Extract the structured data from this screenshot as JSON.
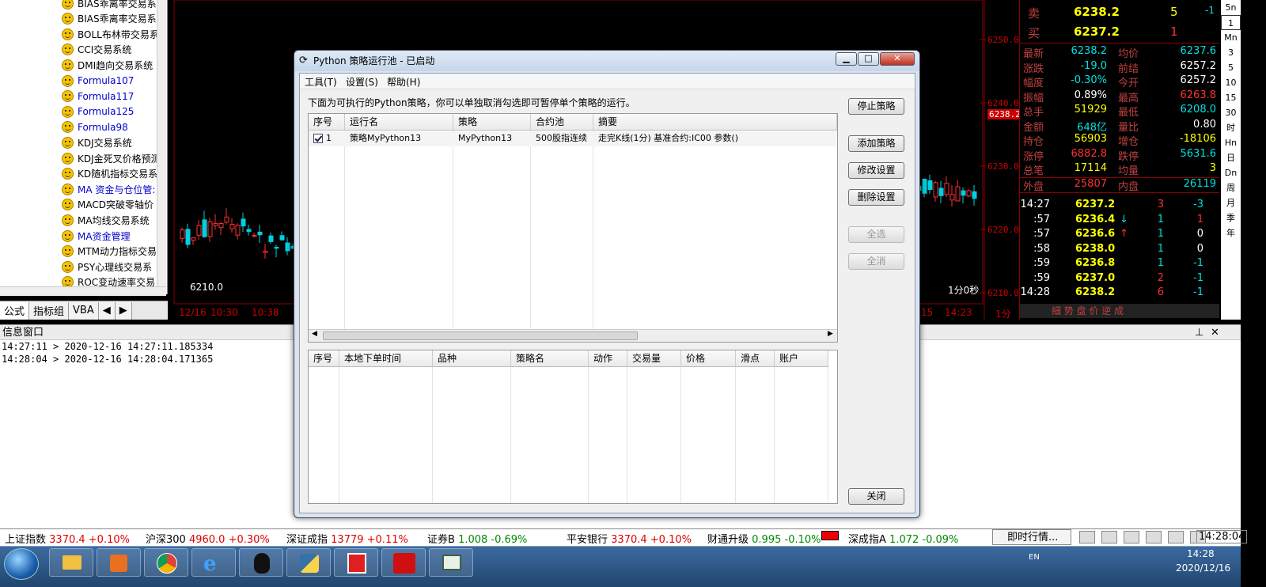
{
  "tree": {
    "items": [
      {
        "label": "BIAS乖离率交易系",
        "blue": false
      },
      {
        "label": "BIAS乖离率交易系",
        "blue": false
      },
      {
        "label": "BOLL布林带交易系",
        "blue": false
      },
      {
        "label": "CCI交易系统",
        "blue": false
      },
      {
        "label": "DMI趋向交易系统",
        "blue": false
      },
      {
        "label": "Formula107",
        "blue": true
      },
      {
        "label": "Formula117",
        "blue": true
      },
      {
        "label": "Formula125",
        "blue": true
      },
      {
        "label": "Formula98",
        "blue": true
      },
      {
        "label": "KDJ交易系统",
        "blue": false
      },
      {
        "label": "KDJ金死叉价格预测",
        "blue": false
      },
      {
        "label": "KD随机指标交易系",
        "blue": false
      },
      {
        "label": "MA 资金与仓位管:",
        "blue": true
      },
      {
        "label": "MACD突破零轴价",
        "blue": false
      },
      {
        "label": "MA均线交易系统",
        "blue": false
      },
      {
        "label": "MA资金管理",
        "blue": true
      },
      {
        "label": "MTM动力指标交易",
        "blue": false
      },
      {
        "label": "PSY心理线交易系",
        "blue": false
      },
      {
        "label": "ROC变动速率交易",
        "blue": false
      }
    ],
    "tabs": [
      "公式",
      "指标组",
      "VBA"
    ]
  },
  "chart": {
    "price_labels": [
      "6250.0",
      "6240.0",
      "6230.0",
      "6220.0",
      "6210.0"
    ],
    "current_price": "6238.2",
    "low_label": "6210.0",
    "time_labels": [
      "12/16",
      "10:30",
      "10:38",
      "15",
      "14:23"
    ],
    "period": "1分",
    "countdown": "1分0秒"
  },
  "quote": {
    "sell": {
      "label": "卖",
      "price": "6238.2",
      "vol": "5",
      "diff": "-1"
    },
    "buy": {
      "label": "买",
      "price": "6237.2",
      "vol": "1"
    },
    "rows": [
      {
        "l1": "最新",
        "v1": "6238.2",
        "c1": "green",
        "l2": "均价",
        "v2": "6237.6",
        "c2": "green"
      },
      {
        "l1": "涨跌",
        "v1": "-19.0",
        "c1": "green",
        "l2": "前结",
        "v2": "6257.2",
        "c2": "white"
      },
      {
        "l1": "幅度",
        "v1": "-0.30%",
        "c1": "green",
        "l2": "今开",
        "v2": "6257.2",
        "c2": "white"
      },
      {
        "l1": "振幅",
        "v1": "0.89%",
        "c1": "white",
        "l2": "最高",
        "v2": "6263.8",
        "c2": "red"
      },
      {
        "l1": "总手",
        "v1": "51929",
        "c1": "yel",
        "l2": "最低",
        "v2": "6208.0",
        "c2": "green"
      },
      {
        "l1": "金额",
        "v1": "648亿",
        "c1": "green",
        "l2": "量比",
        "v2": "0.80",
        "c2": "white"
      },
      {
        "l1": "持仓",
        "v1": "56903",
        "c1": "yel",
        "l2": "增仓",
        "v2": "-18106",
        "c2": "yel"
      },
      {
        "l1": "涨停",
        "v1": "6882.8",
        "c1": "red",
        "l2": "跌停",
        "v2": "5631.6",
        "c2": "green"
      },
      {
        "l1": "总笔",
        "v1": "17114",
        "c1": "yel",
        "l2": "均量",
        "v2": "3",
        "c2": "yel"
      },
      {
        "l1": "外盘",
        "v1": "25807",
        "c1": "red",
        "l2": "内盘",
        "v2": "26119",
        "c2": "green"
      }
    ],
    "ticks": [
      {
        "t": "14:27",
        "p": "6237.2",
        "a": "",
        "q": "3",
        "d": "-3"
      },
      {
        "t": ":57",
        "p": "6236.4",
        "a": "↓",
        "q": "1",
        "d": "1"
      },
      {
        "t": ":57",
        "p": "6236.6",
        "a": "↑",
        "q": "1",
        "d": "0"
      },
      {
        "t": ":58",
        "p": "6238.0",
        "a": "",
        "q": "1",
        "d": "0"
      },
      {
        "t": ":59",
        "p": "6236.8",
        "a": "",
        "q": "1",
        "d": "-1"
      },
      {
        "t": ":59",
        "p": "6237.0",
        "a": "",
        "q": "2",
        "d": "-1"
      },
      {
        "t": "14:28",
        "p": "6238.2",
        "a": "",
        "q": "6",
        "d": "-1"
      }
    ],
    "bottom_tabs": "細 势 盘 价 逆 成"
  },
  "sidebar": [
    "5n",
    "1",
    "Mn",
    "3",
    "5",
    "10",
    "15",
    "30",
    "时",
    "Hn",
    "日",
    "Dn",
    "周",
    "月",
    "季",
    "年"
  ],
  "info": {
    "title": "信息窗口",
    "lines": [
      "14:27:11 > 2020-12-16 14:27:11.185334",
      "14:28:04 > 2020-12-16 14:28:04.171365"
    ]
  },
  "ticker": [
    {
      "name": "上证指数",
      "val": "3370.4 +0.10%",
      "c": "v"
    },
    {
      "name": "沪深300",
      "val": "4960.0 +0.30%",
      "c": "v"
    },
    {
      "name": "深证成指",
      "val": "13779 +0.11%",
      "c": "v"
    },
    {
      "name": "证券B",
      "val": "1.008 -0.69%",
      "c": "g"
    },
    {
      "name": "平安银行",
      "val": "3370.4 +0.10%",
      "c": "v"
    },
    {
      "name": "财通升级",
      "val": "0.995 -0.10%",
      "c": "g"
    },
    {
      "name": "深成指A",
      "val": "1.072 -0.09%",
      "c": "g"
    }
  ],
  "ticker_right": {
    "realtime": "即时行情...",
    "time": "14:28:04"
  },
  "taskbar": {
    "time": "14:28",
    "date": "2020/12/16",
    "lang": "EN"
  },
  "dialog": {
    "title": "Python 策略运行池 - 已启动",
    "menu": [
      "工具(T)",
      "设置(S)",
      "帮助(H)"
    ],
    "description": "下面为可执行的Python策略，你可以单独取消勾选即可暂停单个策略的运行。",
    "strategy_columns": [
      "序号",
      "运行名",
      "策略",
      "合约池",
      "摘要"
    ],
    "strategies": [
      {
        "no": "1",
        "run_name": "策略MyPython13",
        "strategy": "MyPython13",
        "pool": "500股指连续",
        "summary": "走完K线(1分) 基准合约:IC00 参数()",
        "checked": true
      }
    ],
    "order_columns": [
      "序号",
      "本地下单时间",
      "品种",
      "策略名",
      "动作",
      "交易量",
      "价格",
      "滑点",
      "账户"
    ],
    "buttons": {
      "stop": "停止策略",
      "add": "添加策略",
      "modify": "修改设置",
      "delete": "删除设置",
      "select_all": "全选",
      "deselect_all": "全消",
      "close": "关闭"
    }
  }
}
